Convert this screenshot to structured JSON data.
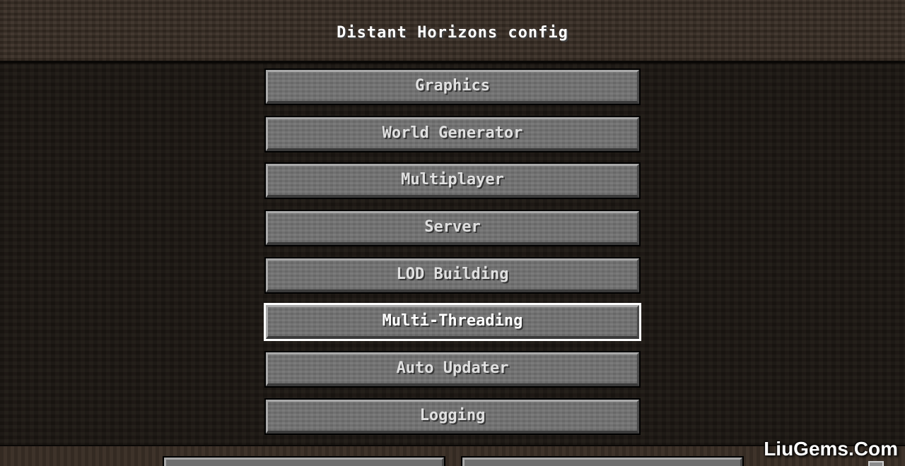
{
  "screen": {
    "title": "Distant Horizons config"
  },
  "menu": {
    "items": [
      {
        "label": "Graphics",
        "selected": false
      },
      {
        "label": "World Generator",
        "selected": false
      },
      {
        "label": "Multiplayer",
        "selected": false
      },
      {
        "label": "Server",
        "selected": false
      },
      {
        "label": "LOD Building",
        "selected": false
      },
      {
        "label": "Multi-Threading",
        "selected": true
      },
      {
        "label": "Auto Updater",
        "selected": false
      },
      {
        "label": "Logging",
        "selected": false
      }
    ]
  },
  "watermark": {
    "text": "LiuGems.Com"
  },
  "colors": {
    "button_face": "#727272",
    "selected_outline": "#ffffff",
    "text": "#e0e0e0"
  }
}
